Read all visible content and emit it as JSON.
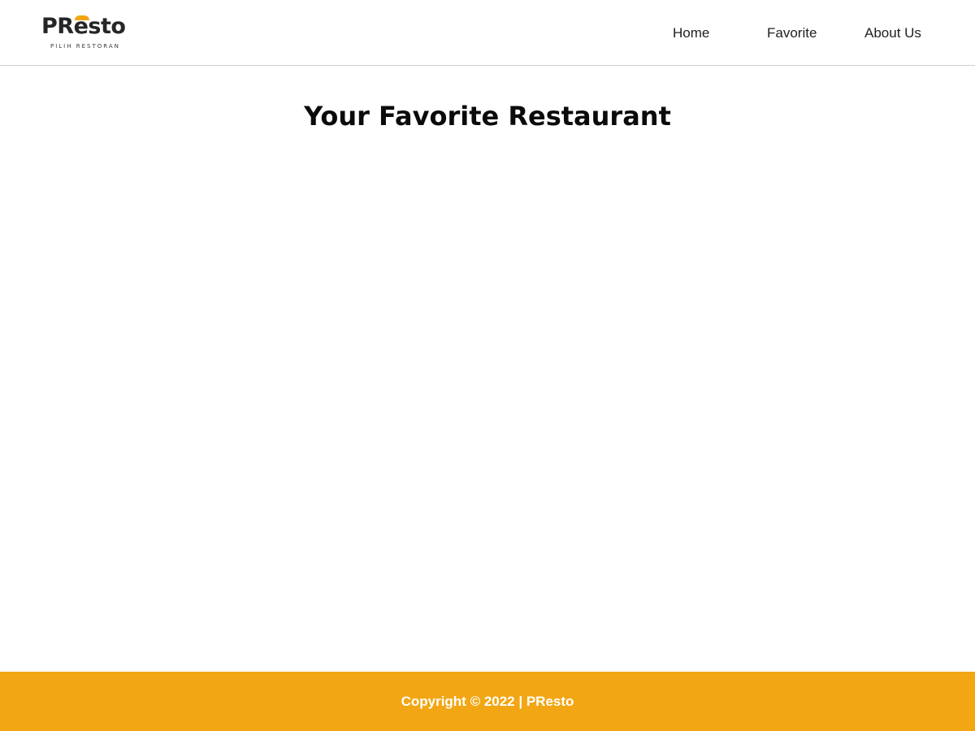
{
  "brand": {
    "name_part1": "PR",
    "name_e": "e",
    "name_part2": "sto",
    "tagline": "PILIH RESTORAN",
    "accent_color": "#f2a613"
  },
  "nav": {
    "items": [
      {
        "label": "Home"
      },
      {
        "label": "Favorite"
      },
      {
        "label": "About Us"
      }
    ]
  },
  "main": {
    "title": "Your Favorite Restaurant"
  },
  "footer": {
    "text": "Copyright © 2022 | PResto",
    "background_color": "#f2a613"
  }
}
